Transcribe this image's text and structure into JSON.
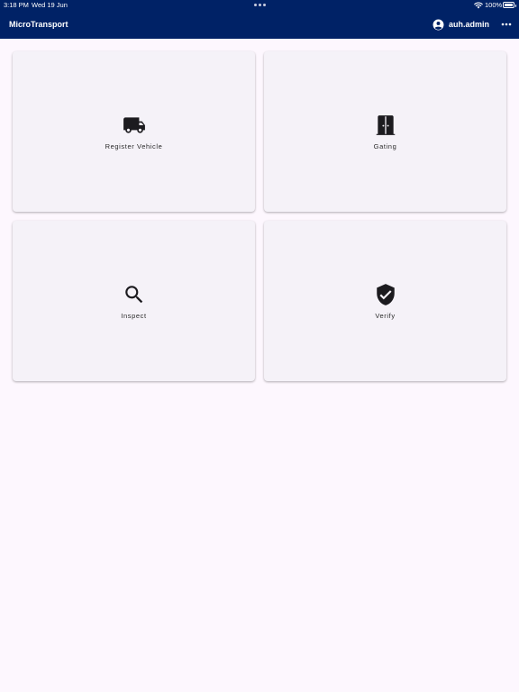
{
  "status_bar": {
    "time": "3:18 PM",
    "date": "Wed 19 Jun",
    "battery": "100%"
  },
  "app_bar": {
    "title": "MicroTransport",
    "user": "auh.admin"
  },
  "tiles": [
    {
      "label": "Register Vehicle",
      "icon": "truck-icon"
    },
    {
      "label": "Gating",
      "icon": "door-icon"
    },
    {
      "label": "Inspect",
      "icon": "search-icon"
    },
    {
      "label": "Verify",
      "icon": "verified-shield-icon"
    }
  ],
  "colors": {
    "app_bar": "#002266",
    "background": "#fdf7fe",
    "tile": "#f5f2f8",
    "icon": "#1c1b1f"
  }
}
